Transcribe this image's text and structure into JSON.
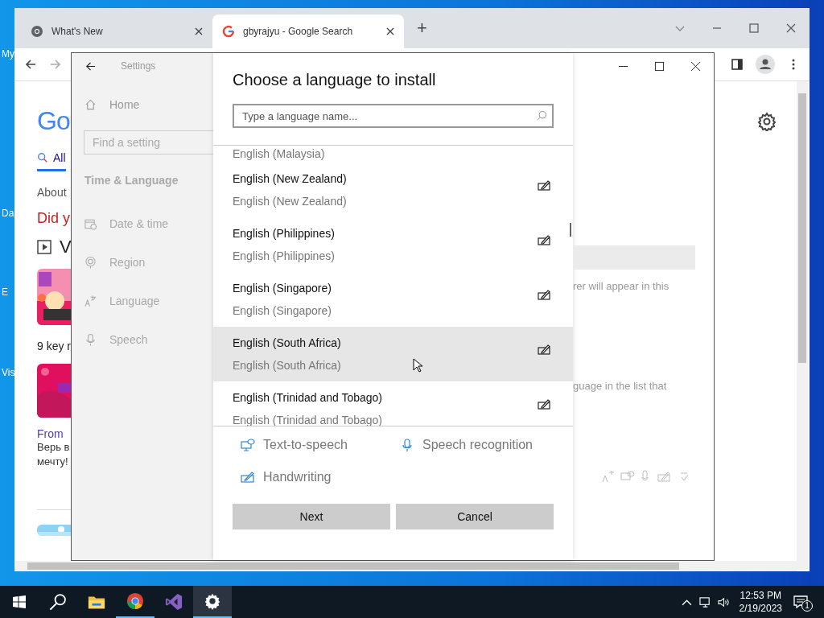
{
  "desktop": {
    "icon_labels": [
      "My",
      "Da",
      "E",
      "Vis"
    ]
  },
  "browser": {
    "tabs": [
      {
        "title": "What's New",
        "selected": false
      },
      {
        "title": "gbyrajyu - Google Search",
        "selected": true
      }
    ],
    "new_tab": "+",
    "page": {
      "logo": "Go",
      "search_tab": "All",
      "result_stats": "About",
      "did_you_mean": "Did y",
      "videos_heading": "V",
      "video_caption": "9 key r",
      "result_link": "From",
      "snippet_lines": [
        "Верь в",
        "мечту!"
      ]
    }
  },
  "settings": {
    "title": "Settings",
    "home": "Home",
    "search": {
      "placeholder": "Find a setting"
    },
    "section": "Time & Language",
    "nav": [
      {
        "label": "Date & time",
        "kind": "date"
      },
      {
        "label": "Region",
        "kind": "region"
      },
      {
        "label": "Language",
        "kind": "language"
      },
      {
        "label": "Speech",
        "kind": "speech"
      }
    ],
    "background_texts": [
      "rer will appear in this",
      "guage in the list that"
    ]
  },
  "dialog": {
    "title": "Choose a language to install",
    "search": {
      "placeholder": "Type a language name..."
    },
    "partial_item": "English (Malaysia)",
    "languages": [
      {
        "name": "English (New Zealand)",
        "native": "English (New Zealand)",
        "handwriting": true,
        "highlighted": false
      },
      {
        "name": "English (Philippines)",
        "native": "English (Philippines)",
        "handwriting": true,
        "highlighted": false
      },
      {
        "name": "English (Singapore)",
        "native": "English (Singapore)",
        "handwriting": true,
        "highlighted": false
      },
      {
        "name": "English (South Africa)",
        "native": "English (South Africa)",
        "handwriting": true,
        "highlighted": true
      },
      {
        "name": "English (Trinidad and Tobago)",
        "native": "English (Trinidad and Tobago)",
        "handwriting": true,
        "highlighted": false
      }
    ],
    "features": [
      {
        "label": "Text-to-speech",
        "kind": "tts"
      },
      {
        "label": "Speech recognition",
        "kind": "speech"
      },
      {
        "label": "Handwriting",
        "kind": "handwriting"
      }
    ],
    "buttons": [
      "Next",
      "Cancel"
    ]
  },
  "taskbar": {
    "apps": [
      {
        "kind": "explorer",
        "running": false,
        "selected": false
      },
      {
        "kind": "chrome",
        "running": true,
        "selected": false
      },
      {
        "kind": "vs",
        "running": false,
        "selected": false
      },
      {
        "kind": "settings",
        "running": true,
        "selected": true
      }
    ],
    "time": "12:53 PM",
    "date": "2/19/2023",
    "notifications": "1"
  }
}
